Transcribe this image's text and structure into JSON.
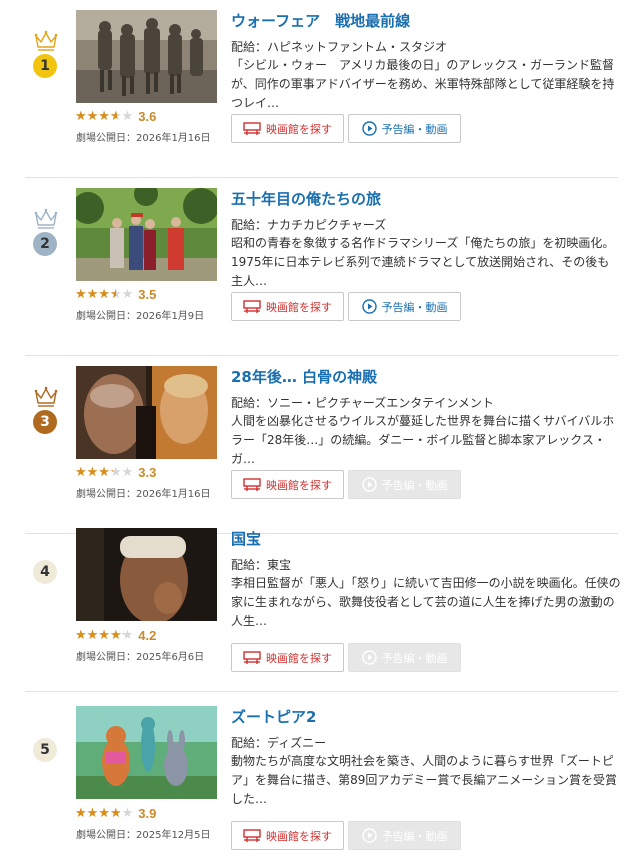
{
  "labels": {
    "release_prefix": "劇場公開日：",
    "distributor_prefix": "配給：",
    "theater_button": "映画館を探す",
    "trailer_button": "予告編・動画"
  },
  "colors": {
    "title": "#1a6fb0",
    "theater_button_text": "#d0302f",
    "trailer_button_text": "#1a6fb0",
    "star": "#d98e1a",
    "score": "#c98a2a",
    "rank_gold": "#f1c40f",
    "rank_silver": "#9fb3c6",
    "rank_bronze": "#b06a1f",
    "rank_plain_bg": "#f0ead8"
  },
  "movies": [
    {
      "rank": "1",
      "crown": "gold",
      "title": "ウォーフェア　戦地最前線",
      "distributor": "配給：ハピネットファントム・スタジオ",
      "synopsis": "「シビル・ウォー　アメリカ最後の日」のアレックス・ガーランド監督が、同作の軍事アドバイザーを務め、米軍特殊部隊として従軍経験を持つレイ…",
      "rating": 3.6,
      "rating_text": "3.6",
      "release": "劇場公開日：2026年1月16日",
      "trailer_available": true,
      "image_icon": "soldiers-photo"
    },
    {
      "rank": "2",
      "crown": "silver",
      "title": "五十年目の俺たちの旅",
      "distributor": "配給：ナカチカピクチャーズ",
      "synopsis": "昭和の青春を象徴する名作ドラマシリーズ「俺たちの旅」を初映画化。1975年に日本テレビ系列で連続ドラマとして放送開始され、その後も主人…",
      "rating": 3.5,
      "rating_text": "3.5",
      "release": "劇場公開日：2026年1月9日",
      "trailer_available": true,
      "image_icon": "people-in-forest-photo"
    },
    {
      "rank": "3",
      "crown": "bronze",
      "title": "28年後… 白骨の神殿",
      "distributor": "配給：ソニー・ピクチャーズエンタテインメント",
      "synopsis": "人間を凶暴化させるウイルスが蔓延した世界を舞台に描くサバイバルホラー「28年後…」の続編。ダニー・ボイル監督と脚本家アレックス・ガ…",
      "rating": 3.3,
      "rating_text": "3.3",
      "release": "劇場公開日：2026年1月16日",
      "trailer_available": false,
      "image_icon": "two-men-closeup-photo"
    },
    {
      "rank": "4",
      "crown": "none",
      "title": "国宝",
      "distributor": "配給：東宝",
      "synopsis": "李相日監督が「悪人」「怒り」に続いて吉田修一の小説を映画化。任侠の家に生まれながら、歌舞伎役者として芸の道に人生を捧げた男の激動の人生…",
      "rating": 4.2,
      "rating_text": "4.2",
      "release": "劇場公開日：2025年6月6日",
      "trailer_available": false,
      "image_icon": "actor-portrait-photo"
    },
    {
      "rank": "5",
      "crown": "none",
      "title": "ズートピア2",
      "distributor": "配給：ディズニー",
      "synopsis": "動物たちが高度な文明社会を築き、人間のように暮らす世界「ズートピア」を舞台に描き、第89回アカデミー賞で長編アニメーション賞を受賞した…",
      "rating": 3.9,
      "rating_text": "3.9",
      "release": "劇場公開日：2025年12月5日",
      "trailer_available": false,
      "image_icon": "animated-animals-photo"
    }
  ]
}
